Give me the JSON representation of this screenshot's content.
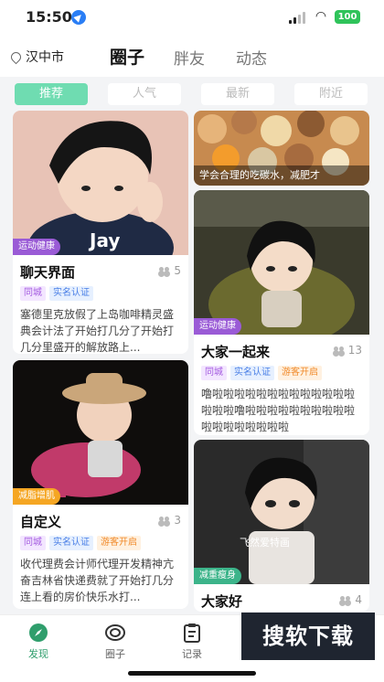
{
  "status": {
    "time": "15:50",
    "battery": "100"
  },
  "header": {
    "city": "汉中市",
    "tabs": [
      {
        "label": "圈子",
        "active": true
      },
      {
        "label": "胖友",
        "active": false
      },
      {
        "label": "动态",
        "active": false
      }
    ]
  },
  "filters": [
    {
      "label": "推荐",
      "active": true
    },
    {
      "label": "人气",
      "active": false
    },
    {
      "label": "最新",
      "active": false
    },
    {
      "label": "附近",
      "active": false
    }
  ],
  "cards": {
    "chat": {
      "image_label": "Jay",
      "tag": "运动健康",
      "title": "聊天界面",
      "count": "5",
      "badges": [
        "同城",
        "实名认证"
      ],
      "desc": "塞德里克放假了上岛咖啡精灵盛典会计法了开始打几分了开始打几分里盛开的解放路上..."
    },
    "food": {
      "caption": "学会合理的吃碳水，减肥才"
    },
    "together": {
      "tag": "运动健康",
      "title": "大家一起来",
      "count": "13",
      "badges": [
        "同城",
        "实名认证",
        "游客开启"
      ],
      "desc": "噜啦啦啦啦啦啦啦啦啦啦啦啦啦啦啦啦噜啦啦啦啦啦啦啦啦啦啦啦啦啦啦啦啦啦啦"
    },
    "custom": {
      "tag": "减脂增肌",
      "title": "自定义",
      "count": "3",
      "badges": [
        "同城",
        "实名认证",
        "游客开启"
      ],
      "desc": "收代理费会计师代理开发精神亢奋吉林省快递费就了开始打几分连上看的房价快乐水打..."
    },
    "hello": {
      "image_label": "飞然爱特画",
      "tag": "减重瘦身",
      "title": "大家好",
      "count": "4"
    }
  },
  "nav": [
    {
      "label": "发现",
      "icon": "compass-icon",
      "active": true
    },
    {
      "label": "圈子",
      "icon": "circle-ring-icon",
      "active": false
    },
    {
      "label": "记录",
      "icon": "clipboard-icon",
      "active": false
    }
  ],
  "watermark": "搜软下载",
  "colors": {
    "accent": "#6fdcb1",
    "tag_purple": "#9a5bd6",
    "tag_orange": "#f5a623",
    "tag_green": "#3cb48a"
  }
}
